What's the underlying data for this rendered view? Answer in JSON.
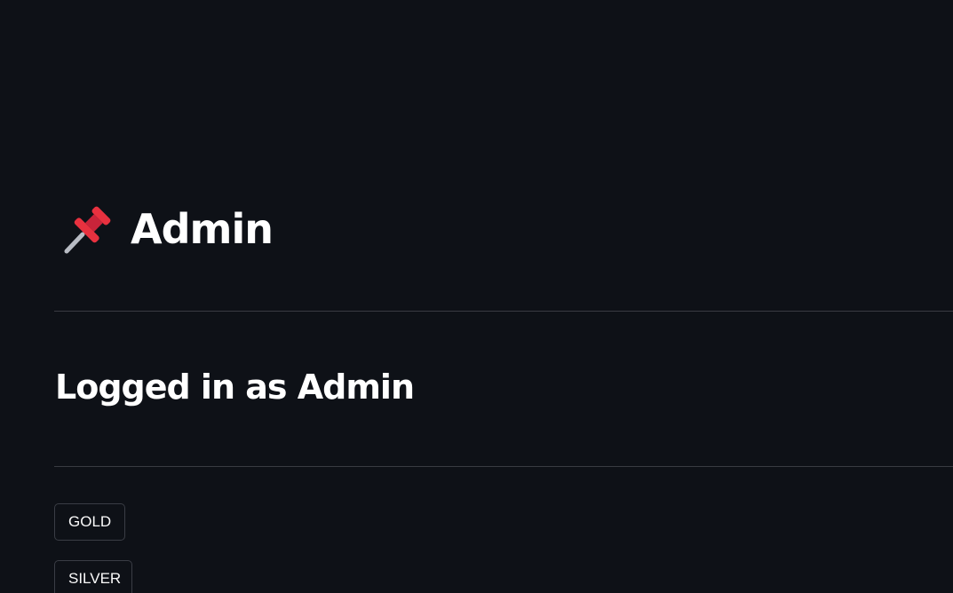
{
  "header": {
    "icon": "pushpin-icon",
    "title": "Admin"
  },
  "status": {
    "logged_in_text": "Logged in as Admin"
  },
  "buttons": [
    {
      "label": "GOLD"
    },
    {
      "label": "SILVER"
    }
  ],
  "colors": {
    "background": "#0e1117",
    "text": "#fafafa",
    "divider": "#393b42",
    "button_border": "#3a3d45",
    "pin_red": "#e8313f",
    "pin_needle": "#b8bcc4"
  }
}
